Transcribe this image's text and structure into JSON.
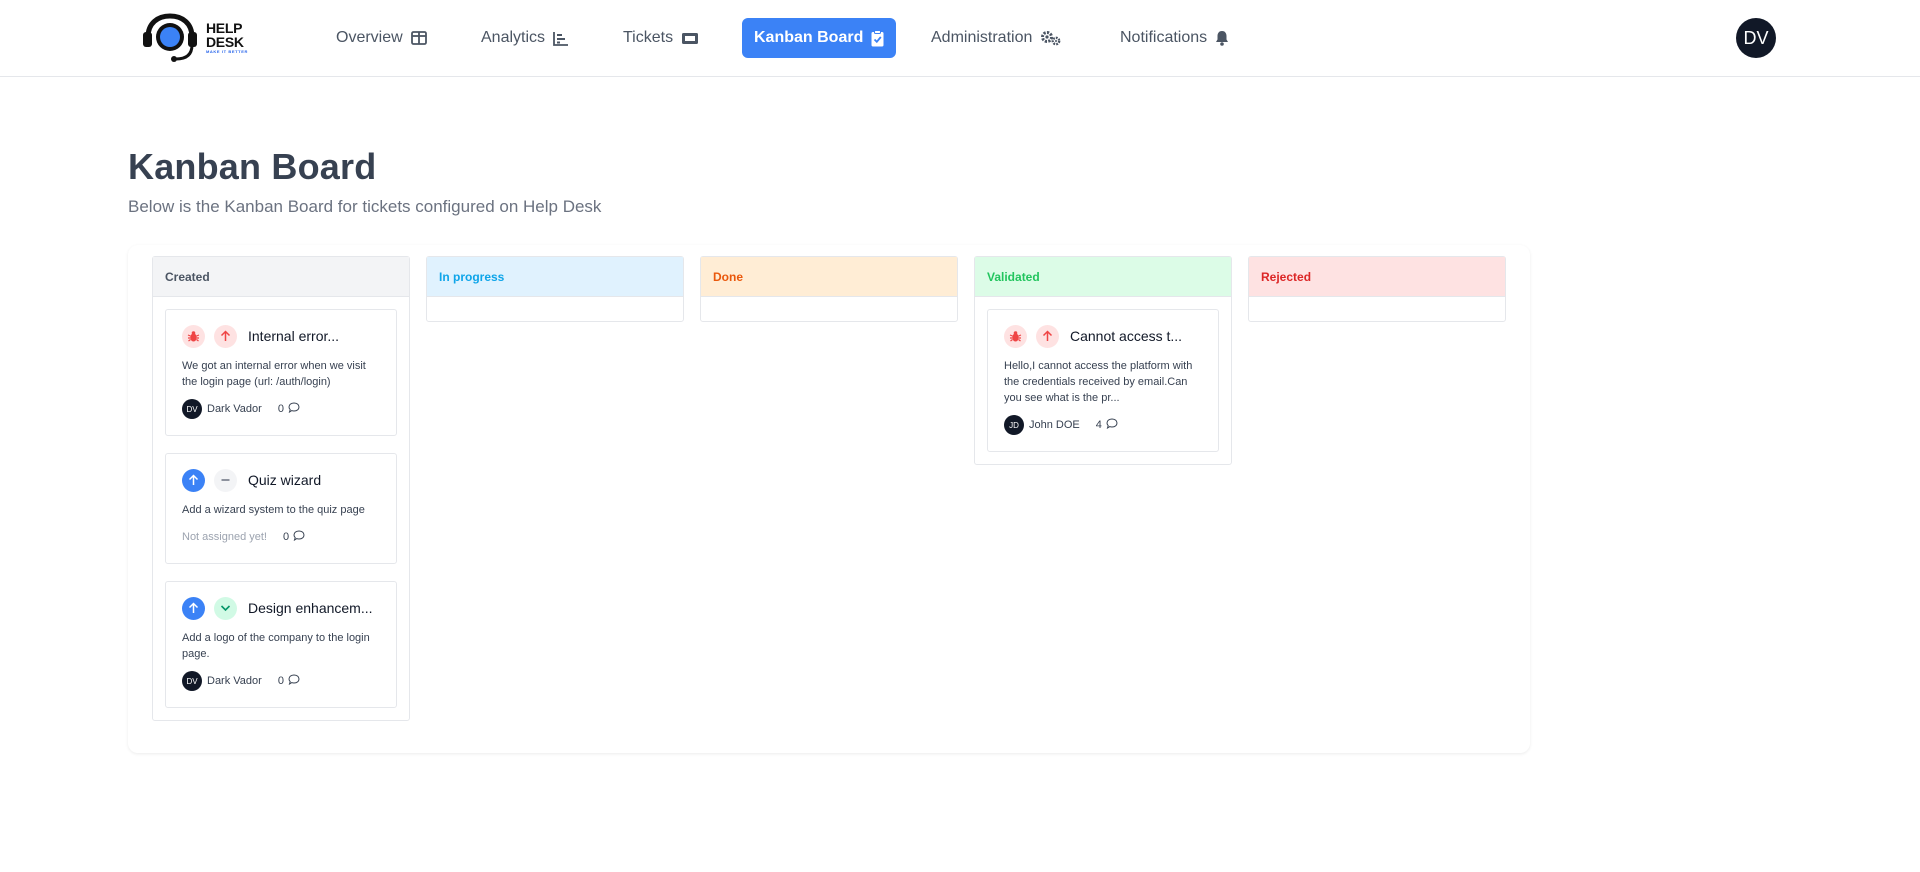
{
  "app": {
    "logo_title": "HELP DESK",
    "logo_tagline": "MAKE IT BETTER",
    "user_initials": "DV"
  },
  "nav": [
    {
      "label": "Overview",
      "icon": "layout-icon",
      "active": false
    },
    {
      "label": "Analytics",
      "icon": "bar-chart-icon",
      "active": false
    },
    {
      "label": "Tickets",
      "icon": "ticket-icon",
      "active": false
    },
    {
      "label": "Kanban Board",
      "icon": "clipboard-check-icon",
      "active": true
    },
    {
      "label": "Administration",
      "icon": "gears-icon",
      "active": false
    },
    {
      "label": "Notifications",
      "icon": "bell-icon",
      "active": false
    }
  ],
  "page": {
    "title": "Kanban Board",
    "subtitle": "Below is the Kanban Board for tickets configured on Help Desk"
  },
  "colors": {
    "accent": "#3b82f6",
    "created_head_bg": "#f3f4f6",
    "created_head_text": "#4b5563",
    "in_progress_head_bg": "#e0f2fe",
    "in_progress_head_text": "#0ea5e9",
    "done_head_bg": "#ffedd5",
    "done_head_text": "#ea580c",
    "validated_head_bg": "#dcfce7",
    "validated_head_text": "#22c55e",
    "rejected_head_bg": "#fee2e2",
    "rejected_head_text": "#dc2626"
  },
  "columns": [
    {
      "title": "Created",
      "cards": [
        {
          "type_icon": "bug-icon",
          "priority_icon": "arrow-up-icon",
          "title": "Internal error...",
          "description": "We got an internal error when we visit the login page (url: /auth/login)",
          "assignee_initials": "DV",
          "assignee": "Dark Vador",
          "comments": "0"
        },
        {
          "type_icon": "arrow-up-icon",
          "priority_icon": "minus-icon",
          "title": "Quiz wizard",
          "description": "Add a wizard system to the quiz page",
          "assignee_initials": "",
          "assignee": "Not assigned yet!",
          "comments": "0"
        },
        {
          "type_icon": "arrow-up-icon",
          "priority_icon": "chevron-down-icon",
          "title": "Design enhancem...",
          "description": "Add a logo of the company to the login page.",
          "assignee_initials": "DV",
          "assignee": "Dark Vador",
          "comments": "0"
        }
      ]
    },
    {
      "title": "In progress",
      "cards": []
    },
    {
      "title": "Done",
      "cards": []
    },
    {
      "title": "Validated",
      "cards": [
        {
          "type_icon": "bug-icon",
          "priority_icon": "arrow-up-icon",
          "title": "Cannot access t...",
          "description": "Hello,I cannot access the platform with the credentials received by email.Can you see what is the pr...",
          "assignee_initials": "JD",
          "assignee": "John DOE",
          "comments": "4"
        }
      ]
    },
    {
      "title": "Rejected",
      "cards": []
    }
  ]
}
